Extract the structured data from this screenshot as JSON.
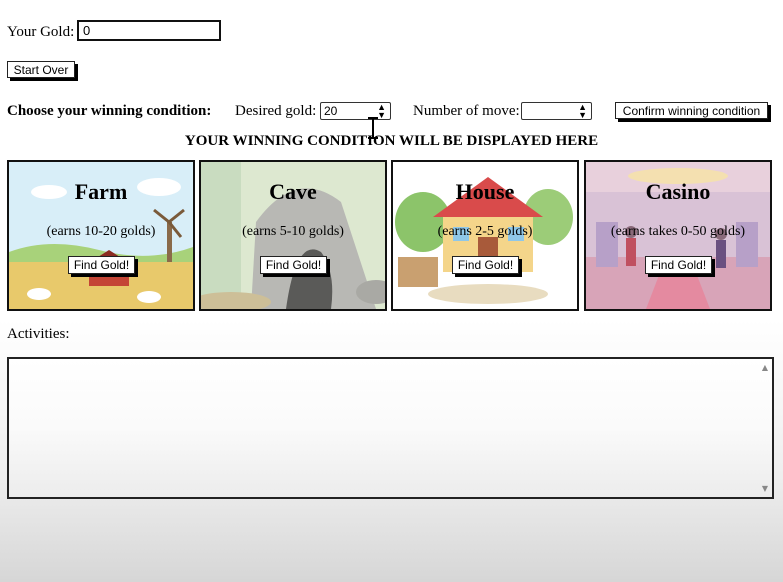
{
  "gold": {
    "label": "Your Gold:",
    "value": "0"
  },
  "start_over": "Start Over",
  "winning": {
    "choose_label": "Choose your winning condition:",
    "desired_label": "Desired gold:",
    "desired_value": "20",
    "moves_label": "Number of move:",
    "moves_value": "",
    "confirm_label": "Confirm winning condition",
    "display_text": "YOUR WINNING CONDITION WILL BE DISPLAYED HERE"
  },
  "locations": [
    {
      "title": "Farm",
      "earn": "(earns 10-20 golds)",
      "button": "Find Gold!",
      "icon": "farm-scene"
    },
    {
      "title": "Cave",
      "earn": "(earns 5-10 golds)",
      "button": "Find Gold!",
      "icon": "cave-scene"
    },
    {
      "title": "House",
      "earn": "(earns 2-5 golds)",
      "button": "Find Gold!",
      "icon": "house-scene"
    },
    {
      "title": "Casino",
      "earn": "(earns takes 0-50 golds)",
      "button": "Find Gold!",
      "icon": "casino-scene"
    }
  ],
  "activities": {
    "label": "Activities:",
    "log": ""
  }
}
